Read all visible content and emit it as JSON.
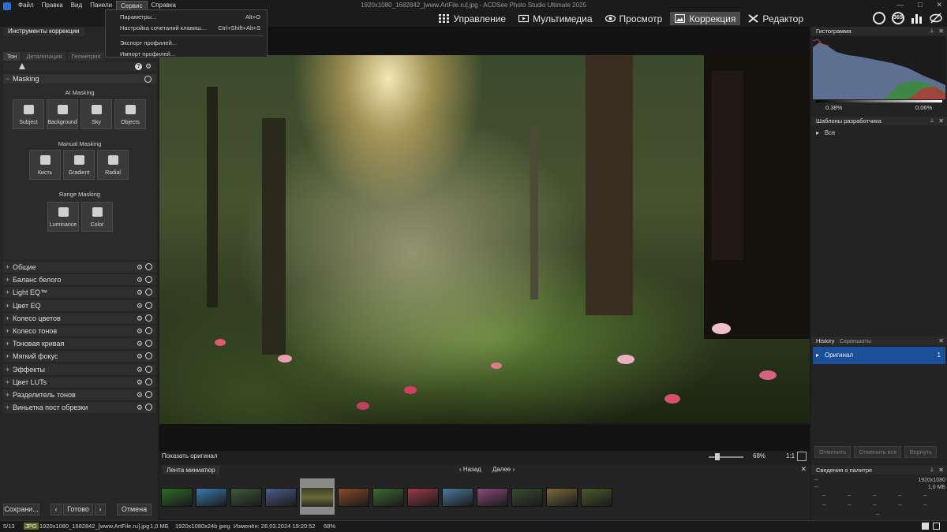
{
  "window": {
    "title": "1920x1080_1682842_[www.ArtFile.ru].jpg - ACDSee Photo Studio Ultimate 2025",
    "controls": [
      "—",
      "□",
      "✕"
    ]
  },
  "menu": {
    "items": [
      "Файл",
      "Правка",
      "Вид",
      "Панели",
      "Сервис",
      "Справка"
    ],
    "active": "Сервис",
    "dropdown": [
      {
        "label": "Параметры...",
        "shortcut": "Alt+O"
      },
      {
        "label": "Настройка сочетаний клавиш...",
        "shortcut": "Ctrl+Shift+Alt+S"
      },
      {
        "label": "Экспорт профилей...",
        "shortcut": ""
      },
      {
        "label": "Импорт профилей...",
        "shortcut": ""
      }
    ]
  },
  "modes": [
    {
      "label": "Управление",
      "icon": "grid-icon"
    },
    {
      "label": "Мультимедиа",
      "icon": "media-icon"
    },
    {
      "label": "Просмотр",
      "icon": "eye-icon"
    },
    {
      "label": "Коррекция",
      "icon": "develop-icon",
      "active": true
    },
    {
      "label": "Редактор",
      "icon": "edit-icon"
    }
  ],
  "right_icons": [
    "globe-icon",
    "360-icon",
    "stats-icon",
    "eye-slash-icon"
  ],
  "right_icon_text": {
    "i360": "365"
  },
  "left_panel": {
    "title": "Инструменты коррекции",
    "tabs": [
      "Тон",
      "Детализация",
      "Геометрия"
    ],
    "masking": {
      "header": "Masking",
      "ai_label": "AI Masking",
      "ai_tools": [
        "Subject",
        "Background",
        "Sky",
        "Objects"
      ],
      "manual_label": "Manual Masking",
      "manual_tools": [
        "Кисть",
        "Gradient",
        "Radial"
      ],
      "range_label": "Range Masking",
      "range_tools": [
        "Luminance",
        "Color"
      ]
    },
    "adjustments": [
      "Общие",
      "Баланс белого",
      "Light EQ™",
      "Цвет EQ",
      "Колесо цветов",
      "Колесо тонов",
      "Тоновая кривая",
      "Мягкий фокус",
      "Эффекты",
      "Цвет LUTs",
      "Разделитель тонов",
      "Виньетка пост обрезки"
    ],
    "buttons": {
      "save": "Сохрани...",
      "done": "Готово",
      "cancel": "Отмена"
    }
  },
  "viewer": {
    "show_original": "Показать оригинал",
    "zoom": "68%",
    "zoom_11": "1:1"
  },
  "filmstrip": {
    "title": "Лента миниатюр",
    "back": "Назад",
    "forward": "Далее",
    "count": 13,
    "selected_index": 4,
    "thumb_colors": [
      "#2f6a2a",
      "#3a7bb0",
      "#3e5a3a",
      "#4a5e8a",
      "#55503a",
      "#8a4a2a",
      "#3e6a30",
      "#9a3a4a",
      "#4a7a9a",
      "#8a4a7a",
      "#3a4a30",
      "#7a6a3a",
      "#4a5a2a"
    ]
  },
  "right_panel": {
    "histogram_title": "Гистограмма",
    "histogram_left": "0.38%",
    "histogram_right": "0.06%",
    "dev_title": "Шаблоны разработчика",
    "dev_all": "Все",
    "history_tab": "History",
    "screenshots_tab": "Скриншоты",
    "history_item": "Оригинал",
    "history_num": "1",
    "undo": "Отменить",
    "undo_all": "Отменить все",
    "redo": "Вернуть",
    "palette_title": "Сведения о палитре",
    "palette_res": "1920x1080",
    "palette_size": "1,0 МБ",
    "palette_dash": "--"
  },
  "status": {
    "index": "5/13",
    "type": "JPG",
    "filename": "1920x1080_1682842_[www.ArtFile.ru].jpg",
    "size": "1,0 МБ",
    "dims": "1920x1080x24b jpeg",
    "modified": "Изменён: 28.03.2024 19:20:52",
    "zoom": "68%"
  }
}
